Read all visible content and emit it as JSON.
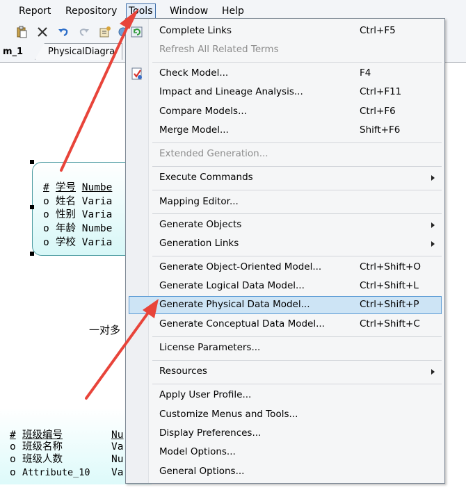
{
  "menubar": {
    "report": "Report",
    "repository": "Repository",
    "tools": "Tools",
    "window": "Window",
    "help": "Help"
  },
  "tabs": {
    "tab1": "m_1",
    "tab2": "PhysicalDiagra"
  },
  "diagram": {
    "entity1": {
      "rows": [
        {
          "key": "#",
          "name": "学号",
          "type": "Numbe"
        },
        {
          "key": "o",
          "name": "姓名",
          "type": "Varia"
        },
        {
          "key": "o",
          "name": "性别",
          "type": "Varia"
        },
        {
          "key": "o",
          "name": "年龄",
          "type": "Numbe"
        },
        {
          "key": "o",
          "name": "学校",
          "type": "Varia"
        }
      ]
    },
    "relationship_label": "一对多",
    "entity2": {
      "rows": [
        {
          "key": "#",
          "name": "班级编号",
          "type": "Nu"
        },
        {
          "key": "o",
          "name": "班级名称",
          "type": "Va"
        },
        {
          "key": "o",
          "name": "班级人数",
          "type": "Nu"
        },
        {
          "key": "o",
          "name": "Attribute_10",
          "type": "Va"
        }
      ]
    }
  },
  "tools_menu": {
    "items": [
      {
        "label": "Complete Links",
        "shortcut": "Ctrl+F5"
      },
      {
        "label": "Refresh All Related Terms",
        "shortcut": ""
      },
      {
        "label": "Check Model...",
        "shortcut": "F4"
      },
      {
        "label": "Impact and Lineage Analysis...",
        "shortcut": "Ctrl+F11"
      },
      {
        "label": "Compare Models...",
        "shortcut": "Ctrl+F6"
      },
      {
        "label": "Merge Model...",
        "shortcut": "Shift+F6"
      },
      {
        "label": "Extended Generation...",
        "shortcut": ""
      },
      {
        "label": "Execute Commands",
        "shortcut": ""
      },
      {
        "label": "Mapping Editor...",
        "shortcut": ""
      },
      {
        "label": "Generate Objects",
        "shortcut": ""
      },
      {
        "label": "Generation Links",
        "shortcut": ""
      },
      {
        "label": "Generate Object-Oriented Model...",
        "shortcut": "Ctrl+Shift+O"
      },
      {
        "label": "Generate Logical Data Model...",
        "shortcut": "Ctrl+Shift+L"
      },
      {
        "label": "Generate Physical Data Model...",
        "shortcut": "Ctrl+Shift+P"
      },
      {
        "label": "Generate Conceptual Data Model...",
        "shortcut": "Ctrl+Shift+C"
      },
      {
        "label": "License Parameters...",
        "shortcut": ""
      },
      {
        "label": "Resources",
        "shortcut": ""
      },
      {
        "label": "Apply User Profile...",
        "shortcut": ""
      },
      {
        "label": "Customize Menus and Tools...",
        "shortcut": ""
      },
      {
        "label": "Display Preferences...",
        "shortcut": ""
      },
      {
        "label": "Model Options...",
        "shortcut": ""
      },
      {
        "label": "General Options...",
        "shortcut": ""
      }
    ]
  },
  "colors": {
    "highlight": "#cde4f5",
    "highlight_border": "#5b9bd5",
    "annotation_arrow": "#e8443a",
    "entity_fill": "#d7f7f7"
  }
}
